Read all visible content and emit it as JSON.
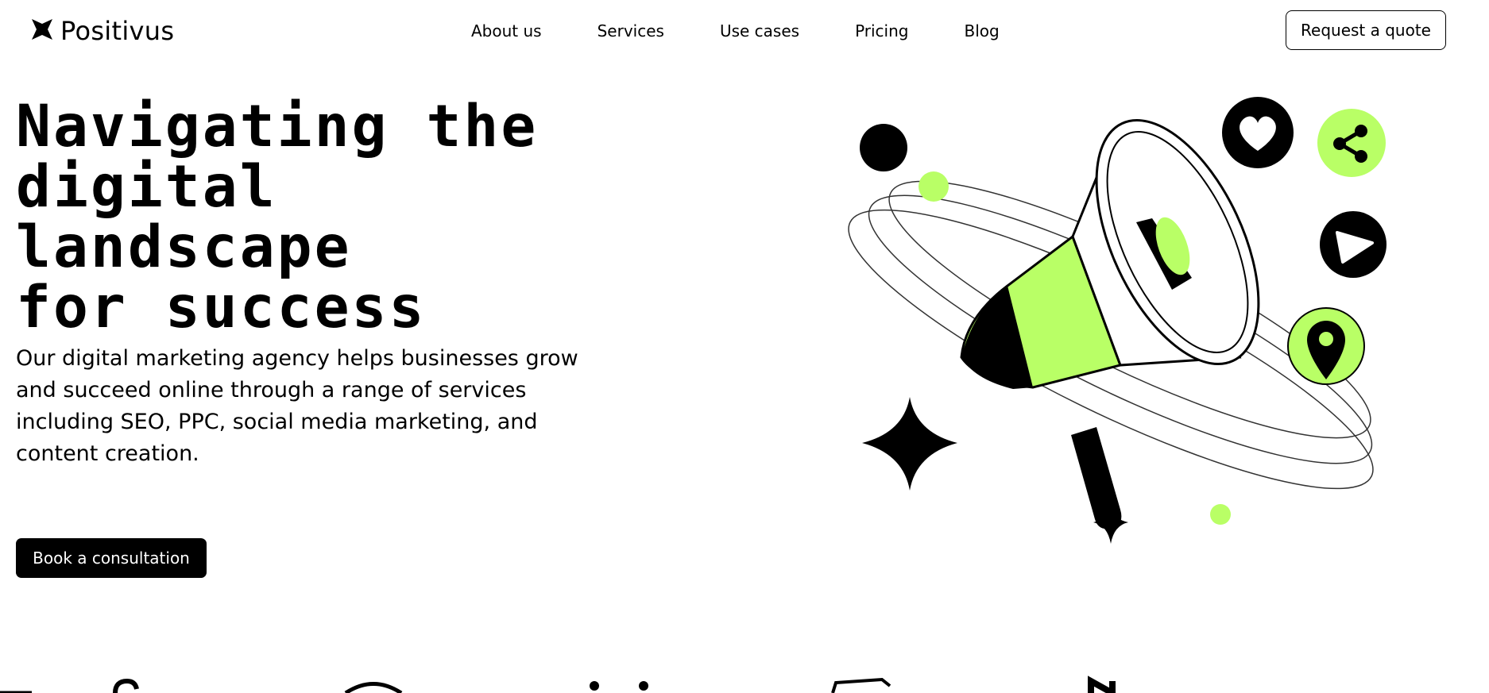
{
  "brand": {
    "name": "Positivus"
  },
  "nav": {
    "items": [
      {
        "label": "About us"
      },
      {
        "label": "Services"
      },
      {
        "label": "Use cases"
      },
      {
        "label": "Pricing"
      },
      {
        "label": "Blog"
      }
    ],
    "cta_label": "Request a quote"
  },
  "hero": {
    "title_lines": [
      "Navigating the",
      "digital landscape",
      "for success"
    ],
    "description": "Our digital marketing agency helps businesses grow and succeed online through a range of services including SEO, PPC, social media marketing, and content creation.",
    "cta_label": "Book a consultation"
  },
  "theme": {
    "accent": "#B9FF66",
    "dark": "#000000",
    "background": "#FFFFFF"
  },
  "illustration": {
    "icons": [
      "megaphone-icon",
      "heart-icon",
      "share-icon",
      "play-icon",
      "location-pin-icon",
      "sparkle-star-icon",
      "small-star-icon"
    ]
  }
}
